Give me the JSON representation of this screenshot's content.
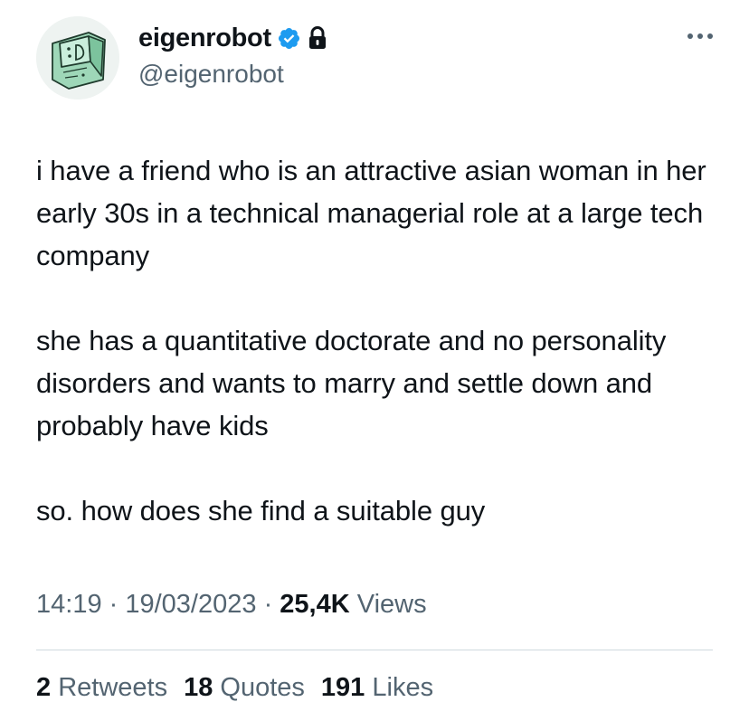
{
  "author": {
    "display_name": "eigenrobot",
    "handle": "@eigenrobot",
    "avatar_icon": "computer-sticker-avatar",
    "verified_icon": "verified-badge-icon",
    "protected_icon": "lock-icon",
    "verified_color": "#1d9bf0"
  },
  "menu": {
    "more_icon": "more-horizontal-icon"
  },
  "tweet": {
    "paragraphs": [
      "i have a friend who is an attractive asian woman in her early 30s in a technical managerial role at a large tech company",
      "she has a quantitative doctorate and no personality disorders and wants to marry and settle down and probably have kids",
      "so. how does she find a suitable guy"
    ]
  },
  "meta": {
    "time": "14:19",
    "sep1": " · ",
    "date": "19/03/2023",
    "sep2": " · ",
    "views_count": "25,4K",
    "views_label": " Views"
  },
  "stats": {
    "retweets_count": "2",
    "retweets_label": " Retweets",
    "quotes_count": "18",
    "quotes_label": " Quotes",
    "likes_count": "191",
    "likes_label": " Likes"
  },
  "colors": {
    "text_primary": "#0f1419",
    "text_secondary": "#536471",
    "divider": "#cfd9de"
  }
}
